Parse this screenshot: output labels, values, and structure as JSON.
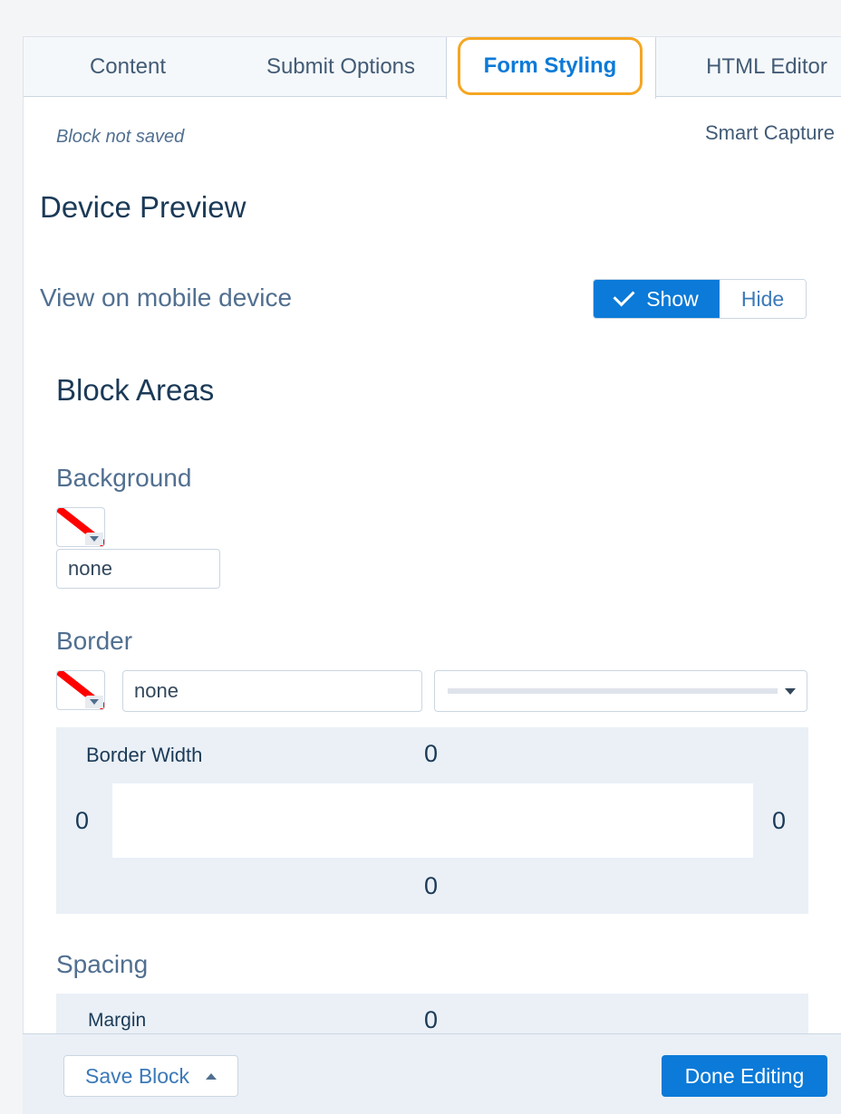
{
  "tabs": {
    "content": "Content",
    "submit_options": "Submit Options",
    "form_styling": "Form Styling",
    "html_editor": "HTML Editor"
  },
  "status": {
    "block_not_saved": "Block not saved",
    "smart_capture": "Smart Capture"
  },
  "device_preview": {
    "heading": "Device Preview",
    "mobile_label": "View on mobile device",
    "show_label": "Show",
    "hide_label": "Hide"
  },
  "block_areas": {
    "heading": "Block Areas",
    "background": {
      "label": "Background",
      "value": "none"
    },
    "border": {
      "label": "Border",
      "color_value": "none",
      "width_title": "Border Width",
      "top": "0",
      "left": "0",
      "right": "0",
      "bottom": "0"
    },
    "spacing": {
      "label": "Spacing",
      "margin_title": "Margin",
      "margin_top": "0"
    }
  },
  "footer": {
    "save_block": "Save Block",
    "done_editing": "Done Editing"
  },
  "colors": {
    "accent": "#0b7ad8",
    "tab_highlight": "#f5a623",
    "no_color_slash": "#ff0000"
  },
  "icons": [
    "check-icon",
    "no-color-swatch-icon",
    "caret-down-icon",
    "caret-up-icon"
  ]
}
